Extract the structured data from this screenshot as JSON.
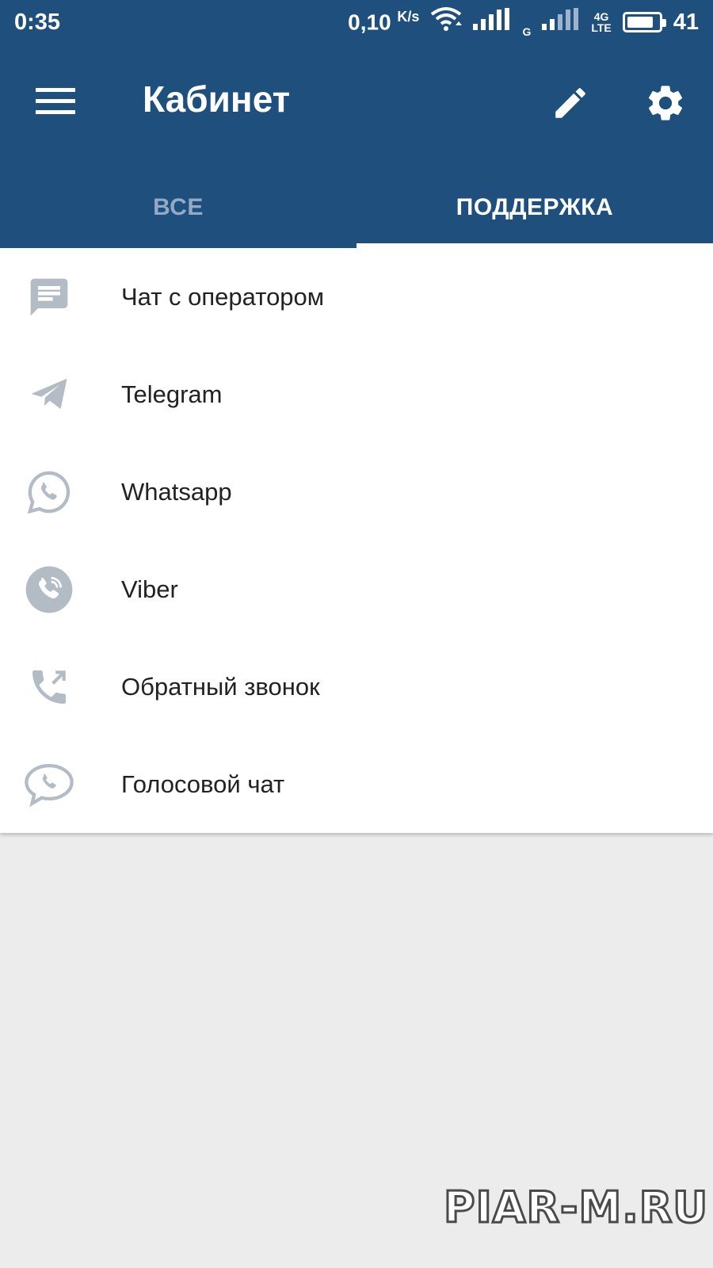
{
  "status_bar": {
    "time": "0:35",
    "net_speed_value": "0,10",
    "net_speed_unit": "K/s",
    "g_label": "G",
    "net_type_top": "4G",
    "net_type_bottom": "LTE",
    "battery_level": 0.85,
    "battery_percent": "41"
  },
  "toolbar": {
    "title": "Кабинет",
    "menu_icon": "hamburger-menu-icon",
    "edit_icon": "pencil-icon",
    "settings_icon": "gear-icon"
  },
  "tabs": [
    {
      "label": "ВСЕ",
      "active": false
    },
    {
      "label": "ПОДДЕРЖКА",
      "active": true
    }
  ],
  "support_items": [
    {
      "label": "Чат с оператором",
      "icon": "chat-message-icon"
    },
    {
      "label": "Telegram",
      "icon": "telegram-icon"
    },
    {
      "label": "Whatsapp",
      "icon": "whatsapp-icon"
    },
    {
      "label": "Viber",
      "icon": "viber-icon"
    },
    {
      "label": "Обратный звонок",
      "icon": "callback-phone-icon"
    },
    {
      "label": "Голосовой чат",
      "icon": "voice-chat-icon"
    }
  ],
  "watermark": "PIAR-M.RU",
  "colors": {
    "app_bar": "#1e4f7d",
    "tab_inactive": "#92aac3",
    "icon_gray": "#b3bcc5",
    "background": "#ececec"
  }
}
